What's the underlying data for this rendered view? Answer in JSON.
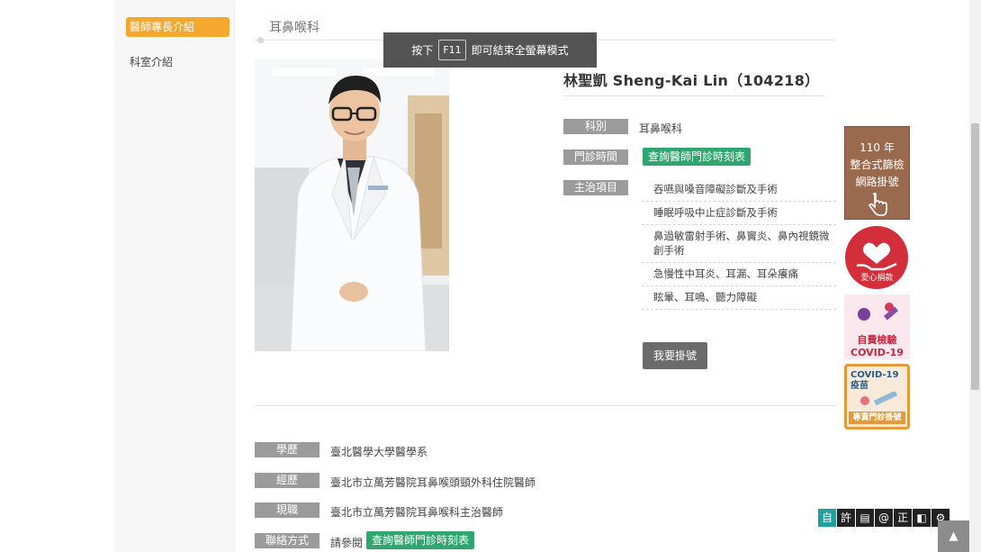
{
  "sidebar": {
    "items": [
      {
        "label": "醫師專長介紹",
        "active": true
      },
      {
        "label": "科室介紹",
        "active": false
      }
    ]
  },
  "section": {
    "title": "耳鼻喉科"
  },
  "doctor": {
    "name": "林聖凱 Sheng-Kai Lin（104218）",
    "department_label": "科別",
    "department": "耳鼻喉科",
    "clinic_label": "門診時間",
    "clinic_button": "查詢醫師門診時刻表",
    "specialty_label": "主治項目",
    "specialties": [
      "吞嚥與嗓音障礙診斷及手術",
      "睡眠呼吸中止症診斷及手術",
      "鼻過敏雷射手術、鼻竇炎、鼻內視鏡微創手術",
      "急慢性中耳炎、耳漏、耳朵癢痛",
      "眩暈、耳鳴、聽力障礙"
    ],
    "register_button": "我要掛號"
  },
  "info": {
    "education_label": "學歷",
    "education": "臺北醫學大學醫學系",
    "experience_label": "經歷",
    "experience": "臺北市立萬芳醫院耳鼻喉頭頸外科住院醫師",
    "current_label": "現職",
    "current": "臺北市立萬芳醫院耳鼻喉科主治醫師",
    "contact_label": "聯絡方式",
    "contact_prefix": "請參閱",
    "contact_button": "查詢醫師門診時刻表"
  },
  "toast": {
    "prefix": "按下",
    "key": "F11",
    "suffix": "即可結束全螢幕模式"
  },
  "promos": {
    "screening": {
      "line1": "110 年",
      "line2": "整合式篩檢",
      "line3": "網路掛號"
    },
    "donation": {
      "label": "愛心捐款"
    },
    "covid_test": {
      "line1": "自費檢驗",
      "line2": "COVID-19"
    },
    "covid_vaccine": {
      "line1": "COVID-19",
      "line2": "疫苗",
      "line3": "專責門診掛號"
    }
  },
  "toolbar": {
    "items": [
      "自",
      "許",
      "▤",
      "@",
      "正",
      "◧",
      "⚙"
    ]
  },
  "to_top": "▲",
  "colors": {
    "accent_orange": "#f4a82e",
    "green_button": "#2fa66f",
    "tag_gray": "#9b9b9b",
    "promo_brown": "#9a6a4e",
    "heart_red": "#d32f3a"
  }
}
